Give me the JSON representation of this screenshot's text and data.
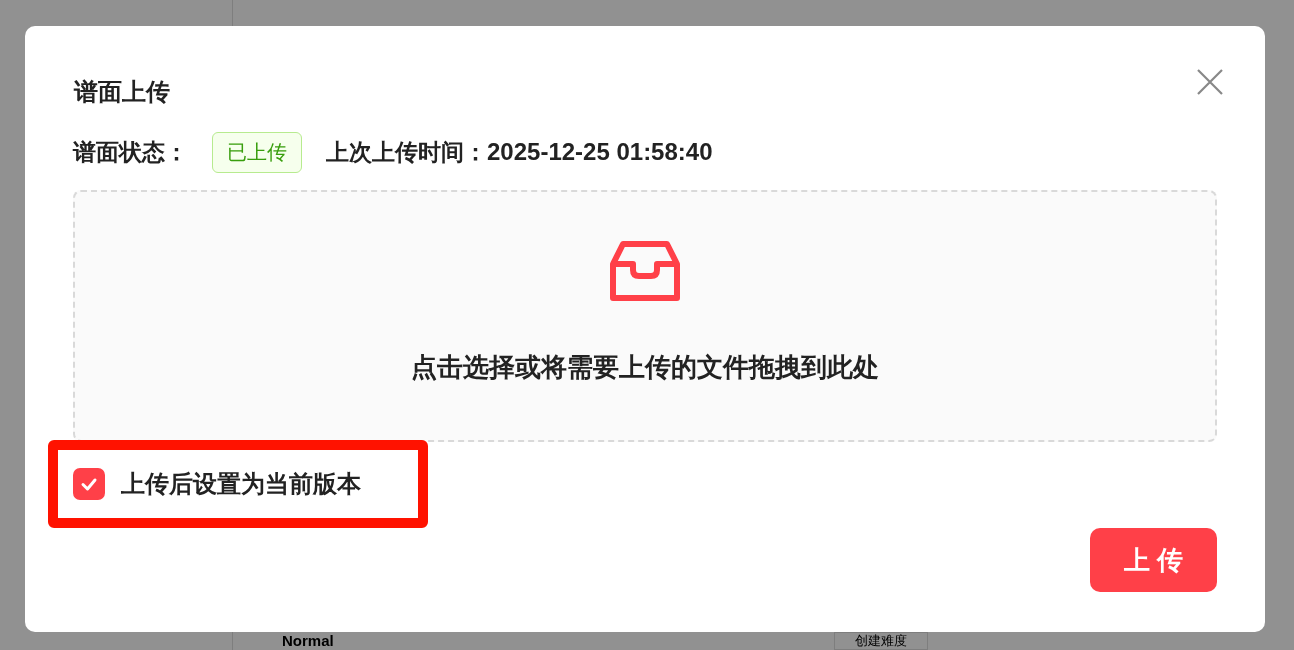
{
  "background_page": {
    "heading": "Normal",
    "create_button": "创建难度"
  },
  "dialog": {
    "title": "谱面上传",
    "status_label": "谱面状态：",
    "status_tag": "已上传",
    "last_upload_label": "上次上传时间：",
    "last_upload_time": "2025-12-25 01:58:40",
    "dropzone": {
      "text": "点击选择或将需要上传的文件拖拽到此处"
    },
    "checkbox": {
      "label": "上传后设置为当前版本",
      "checked": true
    },
    "annotation": {
      "kind": "highlight-box"
    },
    "submit_button": "上 传"
  }
}
